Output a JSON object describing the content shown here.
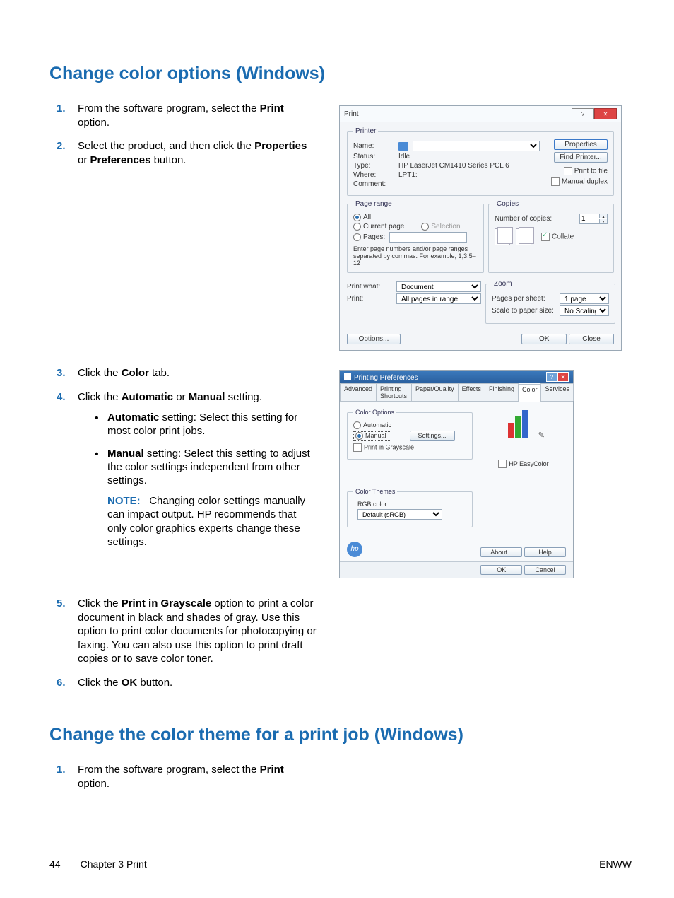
{
  "section1": {
    "title": "Change color options (Windows)",
    "steps": {
      "s1a": "From the software program, select the ",
      "s1b": "Print",
      "s1c": " option.",
      "s2a": "Select the product, and then click the ",
      "s2b": "Properties",
      "s2c": " or ",
      "s2d": "Preferences",
      "s2e": " button.",
      "s3a": "Click the ",
      "s3b": "Color",
      "s3c": " tab.",
      "s4a": "Click the ",
      "s4b": "Automatic",
      "s4c": " or ",
      "s4d": "Manual",
      "s4e": " setting.",
      "auto_b": "Automatic",
      "auto_t": " setting: Select this setting for most color print jobs.",
      "man_b": "Manual",
      "man_t": " setting: Select this setting to adjust the color settings independent from other settings.",
      "note_l": "NOTE:",
      "note_t": "Changing color settings manually can impact output. HP recommends that only color graphics experts change these settings.",
      "s5a": "Click the ",
      "s5b": "Print in Grayscale",
      "s5c": " option to print a color document in black and shades of gray. Use this option to print color documents for photocopying or faxing. You can also use this option to print draft copies or to save color toner.",
      "s6a": "Click the ",
      "s6b": "OK",
      "s6c": " button."
    }
  },
  "section2": {
    "title": "Change the color theme for a print job (Windows)",
    "s1a": "From the software program, select the ",
    "s1b": "Print",
    "s1c": " option."
  },
  "print_dialog": {
    "title": "Print",
    "printer_legend": "Printer",
    "name_l": "Name:",
    "status_l": "Status:",
    "status_v": "Idle",
    "type_l": "Type:",
    "type_v": "HP LaserJet CM1410 Series PCL 6",
    "where_l": "Where:",
    "where_v": "LPT1:",
    "comment_l": "Comment:",
    "properties": "Properties",
    "find_printer": "Find Printer...",
    "print_to_file": "Print to file",
    "manual_duplex": "Manual duplex",
    "page_range": "Page range",
    "all": "All",
    "current": "Current page",
    "selection": "Selection",
    "pages": "Pages:",
    "pages_hint": "Enter page numbers and/or page ranges separated by commas.  For example, 1,3,5–12",
    "copies": "Copies",
    "num_copies": "Number of copies:",
    "num_copies_v": "1",
    "collate": "Collate",
    "print_what_l": "Print what:",
    "print_what_v": "Document",
    "print_l": "Print:",
    "print_v": "All pages in range",
    "zoom": "Zoom",
    "pps_l": "Pages per sheet:",
    "pps_v": "1 page",
    "scale_l": "Scale to paper size:",
    "scale_v": "No Scaling",
    "options": "Options...",
    "ok": "OK",
    "close": "Close"
  },
  "pref_dialog": {
    "title": "Printing Preferences",
    "tabs": [
      "Advanced",
      "Printing Shortcuts",
      "Paper/Quality",
      "Effects",
      "Finishing",
      "Color",
      "Services"
    ],
    "color_options": "Color Options",
    "automatic": "Automatic",
    "manual": "Manual",
    "settings": "Settings...",
    "grayscale": "Print in Grayscale",
    "easycolor": "HP EasyColor",
    "color_themes": "Color Themes",
    "rgb_l": "RGB color:",
    "rgb_v": "Default (sRGB)",
    "about": "About...",
    "help": "Help",
    "ok": "OK",
    "cancel": "Cancel"
  },
  "footer": {
    "page": "44",
    "chapter": "Chapter 3   Print",
    "enww": "ENWW"
  }
}
